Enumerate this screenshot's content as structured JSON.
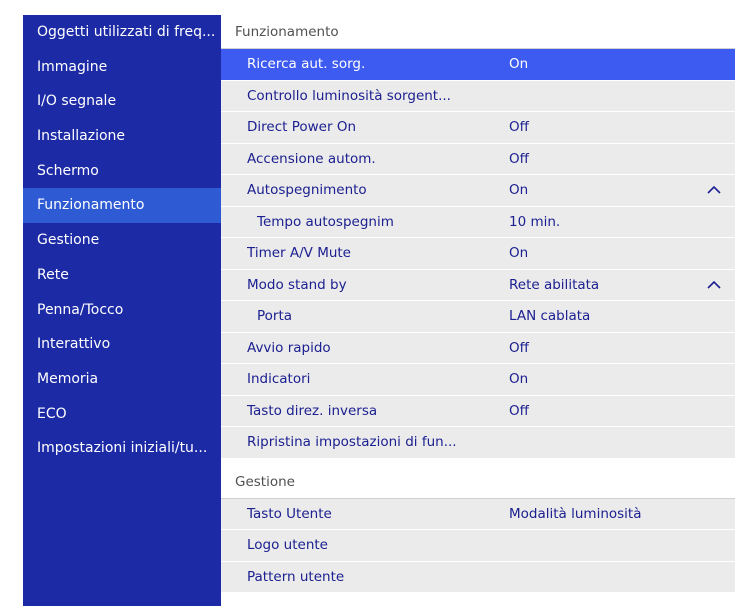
{
  "sidebar": {
    "items": [
      {
        "label": "Oggetti utilizzati di freq...",
        "active": false
      },
      {
        "label": "Immagine",
        "active": false
      },
      {
        "label": "I/O segnale",
        "active": false
      },
      {
        "label": "Installazione",
        "active": false
      },
      {
        "label": "Schermo",
        "active": false
      },
      {
        "label": "Funzionamento",
        "active": true
      },
      {
        "label": "Gestione",
        "active": false
      },
      {
        "label": "Rete",
        "active": false
      },
      {
        "label": "Penna/Tocco",
        "active": false
      },
      {
        "label": "Interattivo",
        "active": false
      },
      {
        "label": "Memoria",
        "active": false
      },
      {
        "label": "ECO",
        "active": false
      },
      {
        "label": "Impostazioni iniziali/tu...",
        "active": false
      }
    ]
  },
  "sections": [
    {
      "header": "Funzionamento",
      "rows": [
        {
          "label": "Ricerca aut. sorg.",
          "value": "On",
          "selected": true
        },
        {
          "label": "Controllo luminosità sorgent...",
          "value": ""
        },
        {
          "label": "Direct Power On",
          "value": "Off"
        },
        {
          "label": "Accensione autom.",
          "value": "Off"
        },
        {
          "label": "Autospegnimento",
          "value": "On",
          "expanded": true,
          "icon": "chevron-up-icon"
        },
        {
          "label": "Tempo autospegnim",
          "value": "10 min.",
          "sub": true
        },
        {
          "label": "Timer A/V Mute",
          "value": "On"
        },
        {
          "label": "Modo stand by",
          "value": "Rete abilitata",
          "expanded": true,
          "icon": "chevron-up-icon"
        },
        {
          "label": "Porta",
          "value": "LAN cablata",
          "sub": true
        },
        {
          "label": "Avvio rapido",
          "value": "Off"
        },
        {
          "label": "Indicatori",
          "value": "On"
        },
        {
          "label": "Tasto direz. inversa",
          "value": "Off"
        },
        {
          "label": "Ripristina impostazioni di fun...",
          "value": ""
        }
      ]
    },
    {
      "header": "Gestione",
      "rows": [
        {
          "label": "Tasto Utente",
          "value": "Modalità luminosità"
        },
        {
          "label": "Logo utente",
          "value": ""
        },
        {
          "label": "Pattern utente",
          "value": ""
        }
      ]
    }
  ],
  "colors": {
    "sidebar_bg": "#1c2aa6",
    "sidebar_active": "#2e5bd4",
    "row_bg": "#ebebeb",
    "row_selected": "#3d5bf0",
    "text_dark_blue": "#1c2090"
  }
}
